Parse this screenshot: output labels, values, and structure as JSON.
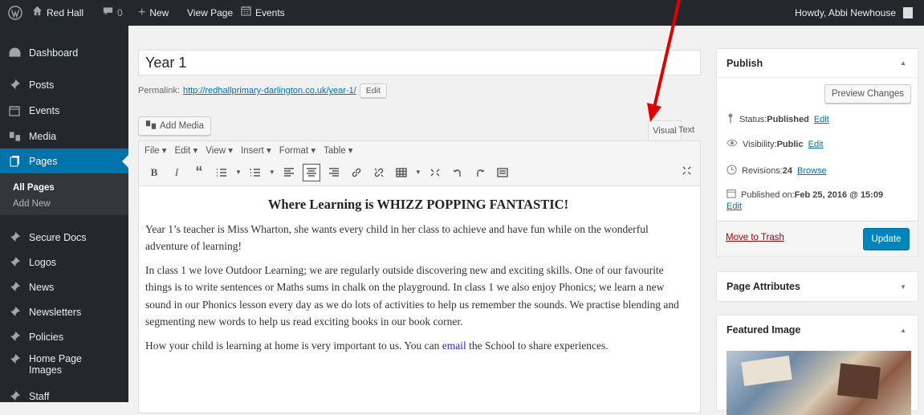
{
  "admin_bar": {
    "site_name": "Red Hall",
    "comments_count": "0",
    "new_label": "New",
    "view_page_label": "View Page",
    "events_label": "Events",
    "howdy_text": "Howdy, Abbi Newhouse"
  },
  "sidebar": {
    "items": [
      {
        "label": "Dashboard",
        "icon": "dashboard-icon"
      },
      {
        "label": "Posts",
        "icon": "pin-icon"
      },
      {
        "label": "Events",
        "icon": "calendar-icon"
      },
      {
        "label": "Media",
        "icon": "media-icon"
      },
      {
        "label": "Pages",
        "icon": "page-icon"
      },
      {
        "label": "Secure Docs",
        "icon": "pin-icon"
      },
      {
        "label": "Logos",
        "icon": "pin-icon"
      },
      {
        "label": "News",
        "icon": "pin-icon"
      },
      {
        "label": "Newsletters",
        "icon": "pin-icon"
      },
      {
        "label": "Policies",
        "icon": "pin-icon"
      },
      {
        "label": "Home Page",
        "label2": "Images",
        "icon": "pin-icon"
      },
      {
        "label": "Staff",
        "icon": "pin-icon"
      }
    ],
    "submenu": [
      "All Pages",
      "Add New"
    ]
  },
  "editor": {
    "title": "Year 1",
    "permalink_label": "Permalink:",
    "permalink_url": "http://redhallprimary-darlington.co.uk/year-1/",
    "permalink_edit": "Edit",
    "add_media": "Add Media",
    "tab_visual": "Visual",
    "tab_text": "Text",
    "menubar": [
      "File ▾",
      "Edit ▾",
      "View ▾",
      "Insert ▾",
      "Format ▾",
      "Table ▾"
    ],
    "content": {
      "heading": "Where Learning is WHIZZ POPPING FANTASTIC!",
      "p1": "Year 1’s teacher is Miss Wharton, she wants every child in her class to achieve and have fun while on the wonderful adventure of learning!",
      "p2": "In class 1 we love Outdoor Learning; we are regularly outside discovering new and exciting skills. One of our favourite things is to write sentences or Maths sums in chalk on the playground. In class 1 we also enjoy Phonics; we learn a new sound in our Phonics lesson every day as we do lots of activities to help us remember the sounds. We practise blending and segmenting new words to help us read exciting books in our book corner.",
      "p3_before": "How your child is learning at home is very important to us. You can ",
      "p3_link": "email",
      "p3_after": " the School to share experiences."
    }
  },
  "publish": {
    "title": "Publish",
    "preview": "Preview Changes",
    "status_label": "Status: ",
    "status_value": "Published",
    "visibility_label": "Visibility: ",
    "visibility_value": "Public",
    "revisions_label": "Revisions: ",
    "revisions_value": "24",
    "browse": "Browse",
    "published_label": "Published on: ",
    "published_value": "Feb 25, 2016 @ 15:09",
    "edit": "Edit",
    "trash": "Move to Trash",
    "update": "Update"
  },
  "page_attributes": {
    "title": "Page Attributes"
  },
  "featured_image": {
    "title": "Featured Image"
  },
  "colors": {
    "accent": "#0073aa",
    "adminbar": "#23282d",
    "arrow": "#e00000"
  }
}
